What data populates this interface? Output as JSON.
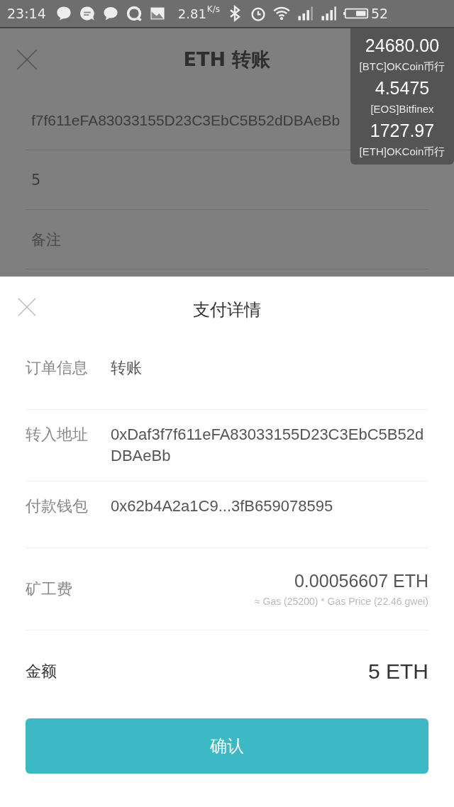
{
  "status_bar": {
    "time": "23:14",
    "speed": "2.81",
    "speed_unit": "K/s",
    "battery": "52"
  },
  "background_screen": {
    "title": "ETH 转账",
    "address": "f7f611eFA83033155D23C3EbC5B52dDBAeBb",
    "amount": "5",
    "memo_placeholder": "备注"
  },
  "ticker": [
    {
      "price": "24680.00",
      "source": "[BTC]OKCoin币行"
    },
    {
      "price": "4.5475",
      "source": "[EOS]Bitfinex"
    },
    {
      "price": "1727.97",
      "source": "[ETH]OKCoin币行"
    }
  ],
  "payment_sheet": {
    "title": "支付详情",
    "rows": [
      {
        "kind": "text",
        "label": "订单信息",
        "value": "转账"
      },
      {
        "kind": "text",
        "label": "转入地址",
        "value": "0xDaf3f7f611eFA83033155D23C3EbC5B52dDBAeBb"
      },
      {
        "kind": "text",
        "label": "付款钱包",
        "value": "0x62b4A2a1C9...3fB659078595"
      },
      {
        "kind": "fee",
        "label": "矿工费",
        "value": "0.00056607 ETH",
        "note": "≈ Gas (25200) * Gas Price (22.46 gwei)"
      },
      {
        "kind": "total",
        "label": "金额",
        "value": "5 ETH"
      }
    ],
    "confirm_button": "确认"
  }
}
